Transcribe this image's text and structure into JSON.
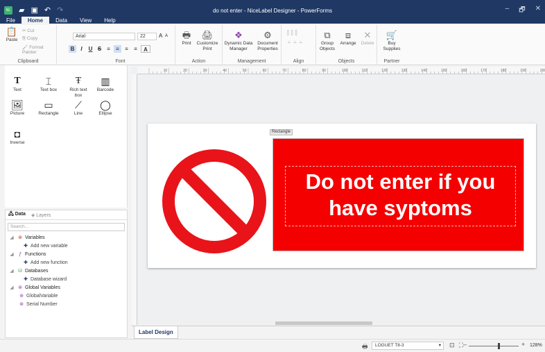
{
  "window": {
    "title": "do not enter - NiceLabel Designer - PowerForms",
    "controls": [
      "–",
      "🗗",
      "✕"
    ]
  },
  "menu": [
    "File",
    "Home",
    "Data",
    "View",
    "Help"
  ],
  "ribbon": {
    "clipboard": {
      "label": "Clipboard",
      "paste": "Paste",
      "cut": "Cut",
      "copy": "Copy",
      "format_painter": "Format Painter"
    },
    "font": {
      "label": "Font",
      "family": "Arial",
      "size": "22"
    },
    "action": {
      "label": "Action",
      "print": "Print",
      "customize_print": "Customize Print"
    },
    "management": {
      "label": "Management",
      "dynamic_data_manager": "Dynamic Data Manager",
      "document_properties": "Document Properties"
    },
    "align": {
      "label": "Align"
    },
    "objects": {
      "label": "Objects",
      "group_objects": "Group Objects",
      "arrange": "Arrange",
      "delete": "Delete"
    },
    "partner": {
      "label": "Partner",
      "buy_supplies": "Buy Supplies"
    }
  },
  "toolbox": [
    {
      "label": "Text",
      "icon": "text-icon"
    },
    {
      "label": "Text box",
      "icon": "textbox-icon"
    },
    {
      "label": "Rich text box",
      "icon": "richtext-icon"
    },
    {
      "label": "Barcode",
      "icon": "barcode-icon"
    },
    {
      "label": "Picture",
      "icon": "picture-icon"
    },
    {
      "label": "Rectangle",
      "icon": "rectangle-icon"
    },
    {
      "label": "Line",
      "icon": "line-icon"
    },
    {
      "label": "Ellipse",
      "icon": "ellipse-icon"
    },
    {
      "label": "Inverse",
      "icon": "inverse-icon"
    }
  ],
  "data_panel": {
    "tabs": [
      "Data",
      "Layers"
    ],
    "search_placeholder": "Search...",
    "tree": [
      "Variables",
      "Add new variable",
      "Functions",
      "Add new function",
      "Databases",
      "Database wizard",
      "Global Variables",
      "GlobalVariable",
      "Serial Number"
    ]
  },
  "canvas": {
    "ruler_ticks": [
      "10",
      "20",
      "30",
      "40",
      "50",
      "60",
      "70",
      "80",
      "90",
      "100",
      "110",
      "120",
      "130",
      "140",
      "150",
      "160",
      "170",
      "180",
      "190",
      "200"
    ],
    "rectangle_tag": "Rectangle",
    "sign_text": "Do not enter if you have syptoms",
    "colors": {
      "sign_red": "#f50000",
      "prohibit_red": "#e8141a"
    }
  },
  "tabs": {
    "label_design": "Label Design"
  },
  "status": {
    "printer": "LOGUET T8-3",
    "zoom": "128%"
  }
}
